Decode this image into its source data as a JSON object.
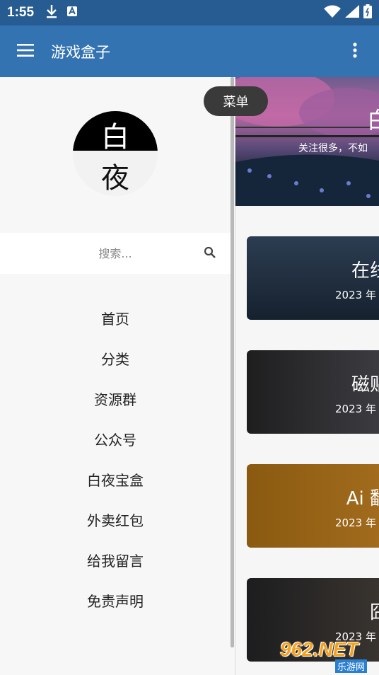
{
  "status_bar": {
    "time": "1:55"
  },
  "app_bar": {
    "title": "游戏盒子"
  },
  "tooltip": {
    "label": "菜单"
  },
  "drawer": {
    "avatar_chars": [
      "白",
      "夜"
    ],
    "search": {
      "placeholder": "搜索..."
    },
    "nav_items": [
      {
        "label": "首页"
      },
      {
        "label": "分类"
      },
      {
        "label": "资源群"
      },
      {
        "label": "公众号"
      },
      {
        "label": "白夜宝盒"
      },
      {
        "label": "外卖红包"
      },
      {
        "label": "给我留言"
      },
      {
        "label": "免责声明"
      }
    ]
  },
  "main": {
    "banner": {
      "title": "白",
      "subtitle": "关注很多，不如"
    },
    "cards": [
      {
        "title": "在线",
        "date": "2023 年"
      },
      {
        "title": "磁贴",
        "date": "2023 年"
      },
      {
        "title": "Ai 翻",
        "date": "2023 年"
      },
      {
        "title": "囧",
        "date": "2023 年"
      }
    ]
  },
  "watermark": {
    "main": "962.NET",
    "sub": "乐游网"
  },
  "colors": {
    "status_bar": "#275c93",
    "app_bar": "#3473b2",
    "drawer_bg": "#f7f7f7",
    "tooltip_bg": "#3a3a3a",
    "card_1": "#1f2e40",
    "card_2": "#2b2b2d",
    "card_3": "#8b5a12",
    "card_4": "#2a2a2a"
  }
}
